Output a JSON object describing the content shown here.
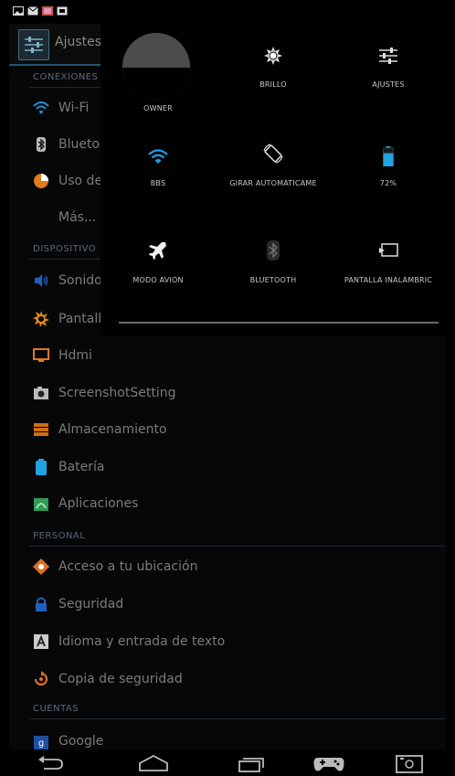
{
  "app": {
    "title": "Ajustes"
  },
  "colors": {
    "accent": "#24596e",
    "wifi": "#1e90ff",
    "battery": "#21a3e0",
    "data_usage": "#e07a1a",
    "screen": "#e08a1a",
    "storage": "#d07010",
    "apps": "#2e9a55",
    "location": "#e07020",
    "security": "#1e60c0",
    "backup": "#e07020"
  },
  "statusbar": {
    "icons": [
      "image-icon",
      "mail-icon",
      "photo-icon",
      "screenshot-icon"
    ]
  },
  "settings": {
    "sections": {
      "connections": "CONEXIONES",
      "device": "DISPOSITIVO",
      "personal": "PERSONAL",
      "accounts": "CUENTAS"
    },
    "connections": [
      {
        "label": "Wi-Fi",
        "icon": "wifi-icon"
      },
      {
        "label": "Bluetoo",
        "icon": "bluetooth-icon"
      },
      {
        "label": "Uso de",
        "icon": "data-usage-icon"
      },
      {
        "label": "Más...",
        "icon": ""
      }
    ],
    "device": [
      {
        "label": "Sonido",
        "icon": "sound-icon"
      },
      {
        "label": "Pantall",
        "icon": "display-icon"
      },
      {
        "label": "Hdmi",
        "icon": "hdmi-icon"
      },
      {
        "label": "ScreenshotSetting",
        "icon": "camera-icon"
      },
      {
        "label": "Almacenamiento",
        "icon": "storage-icon"
      },
      {
        "label": "Batería",
        "icon": "battery-icon"
      },
      {
        "label": "Aplicaciones",
        "icon": "apps-icon"
      }
    ],
    "personal": [
      {
        "label": "Acceso a tu ubicación",
        "icon": "location-icon"
      },
      {
        "label": "Seguridad",
        "icon": "lock-icon"
      },
      {
        "label": "Idioma y entrada de texto",
        "icon": "language-icon"
      },
      {
        "label": "Copia de seguridad",
        "icon": "backup-icon"
      }
    ],
    "accounts": [
      {
        "label": "Google",
        "icon": "google-icon"
      }
    ]
  },
  "quick_settings": {
    "tiles": [
      {
        "label": "OWNER",
        "icon": "avatar"
      },
      {
        "label": "BRILLO",
        "icon": "brightness-icon"
      },
      {
        "label": "AJUSTES",
        "icon": "settings-sliders-icon"
      },
      {
        "label": "BBS",
        "icon": "wifi-icon"
      },
      {
        "label": "GIRAR AUTOMÁTICAME",
        "icon": "rotate-icon"
      },
      {
        "label": "72%",
        "icon": "battery-icon"
      },
      {
        "label": "MODO AVIÓN",
        "icon": "airplane-icon"
      },
      {
        "label": "BLUETOOTH",
        "icon": "bluetooth-icon"
      },
      {
        "label": "PANTALLA INALÁMBRIC",
        "icon": "cast-icon"
      }
    ],
    "battery_level": 0.72
  },
  "navbar": {
    "buttons": [
      "back-icon",
      "home-icon",
      "recents-icon",
      "gamepad-icon",
      "screenshot-icon"
    ]
  }
}
